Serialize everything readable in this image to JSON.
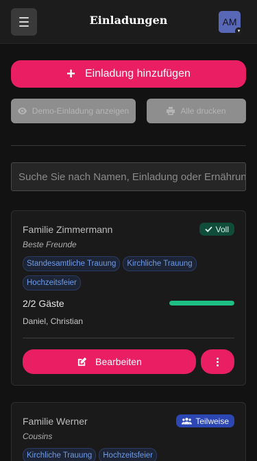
{
  "header": {
    "title": "Einladungen",
    "avatar_initials": "AM",
    "menu_icon": "hamburger-menu-icon",
    "avatar_caret_icon": "chevron-down-icon"
  },
  "actions": {
    "add_label": "Einladung hinzufügen",
    "add_icon": "plus-icon",
    "demo_label": "Demo-Einladung anzeigen",
    "demo_icon": "eye-icon",
    "print_label": "Alle drucken",
    "print_icon": "printer-icon"
  },
  "search": {
    "placeholder": "Suche Sie nach Namen, Einladung oder Ernährung"
  },
  "invitations": [
    {
      "family": "Familie Zimmermann",
      "relation": "Beste Freunde",
      "status": "Voll",
      "status_icon": "check-icon",
      "tags": [
        "Standesamtliche Trauung",
        "Kirchliche Trauung",
        "Hochzeitsfeier"
      ],
      "guest_count": "2/2 Gäste",
      "guest_progress": 1.0,
      "guests": "Daniel, Christian",
      "edit_label": "Bearbeiten",
      "edit_icon": "edit-icon",
      "more_icon": "more-vertical-icon"
    },
    {
      "family": "Familie Werner",
      "relation": "Cousins",
      "status": "Teilweise",
      "status_icon": "users-icon",
      "tags": [
        "Kirchliche Trauung",
        "Hochzeitsfeier"
      ]
    }
  ],
  "colors": {
    "accent": "#e91e63",
    "background": "#121212",
    "card": "#1a1a1a",
    "status_full": "#0f4d3a",
    "status_partial": "#2c46b3",
    "tag_text": "#6f9be8",
    "progress": "#1dbf84"
  }
}
